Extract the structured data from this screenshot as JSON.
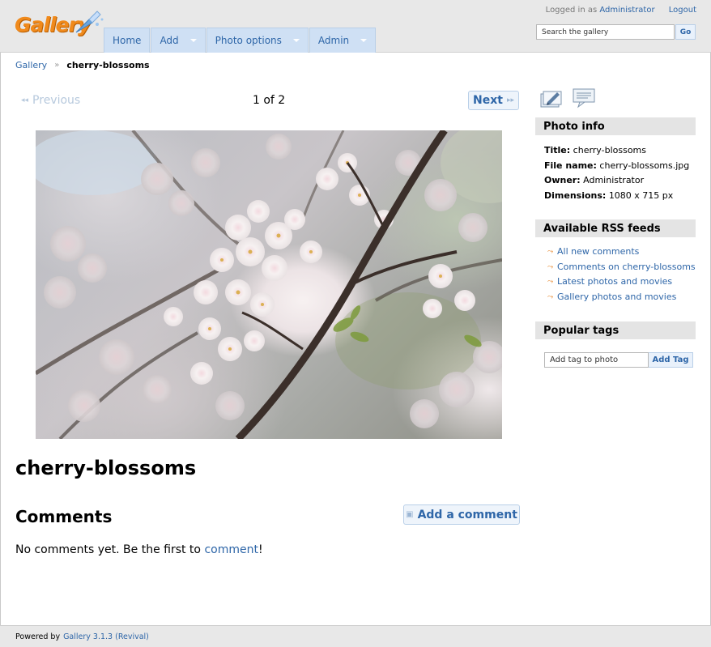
{
  "header": {
    "logo_text": "Gallery",
    "logged_in_prefix": "Logged in as",
    "user": "Administrator",
    "logout": "Logout",
    "search_placeholder": "Search the gallery",
    "search_go": "Go",
    "menu": [
      {
        "label": "Home",
        "has_caret": false
      },
      {
        "label": "Add",
        "has_caret": true
      },
      {
        "label": "Photo options",
        "has_caret": true
      },
      {
        "label": "Admin",
        "has_caret": true
      }
    ]
  },
  "breadcrumb": {
    "root": "Gallery",
    "separator": "»",
    "current": "cherry-blossoms"
  },
  "pager": {
    "previous": "Previous",
    "count": "1 of 2",
    "next": "Next"
  },
  "photo": {
    "title": "cherry-blossoms",
    "subject": "cherry blossom branches"
  },
  "comments": {
    "heading": "Comments",
    "add_button": "Add a comment",
    "empty_prefix": "No comments yet. Be the first to",
    "empty_link": "comment",
    "empty_suffix": "!"
  },
  "sidebar": {
    "photo_info": {
      "heading": "Photo info",
      "title_label": "Title:",
      "title_value": "cherry-blossoms",
      "filename_label": "File name:",
      "filename_value": "cherry-blossoms.jpg",
      "owner_label": "Owner:",
      "owner_value": "Administrator",
      "dimensions_label": "Dimensions:",
      "dimensions_value": "1080 x 715 px"
    },
    "rss": {
      "heading": "Available RSS feeds",
      "items": [
        "All new comments",
        "Comments on cherry-blossoms",
        "Latest photos and movies",
        "Gallery photos and movies"
      ]
    },
    "tags": {
      "heading": "Popular tags",
      "input_placeholder": "Add tag to photo",
      "button": "Add Tag"
    }
  },
  "footer": {
    "powered_by": "Powered by",
    "version_link": "Gallery 3.1.3 (Revival)"
  },
  "colors": {
    "link": "#2e66a8",
    "menu_bg": "#cfe0f4",
    "logo_orange": "#f08a1c",
    "rss_orange": "#e7892f",
    "block_head_bg": "#e4e4e4"
  }
}
